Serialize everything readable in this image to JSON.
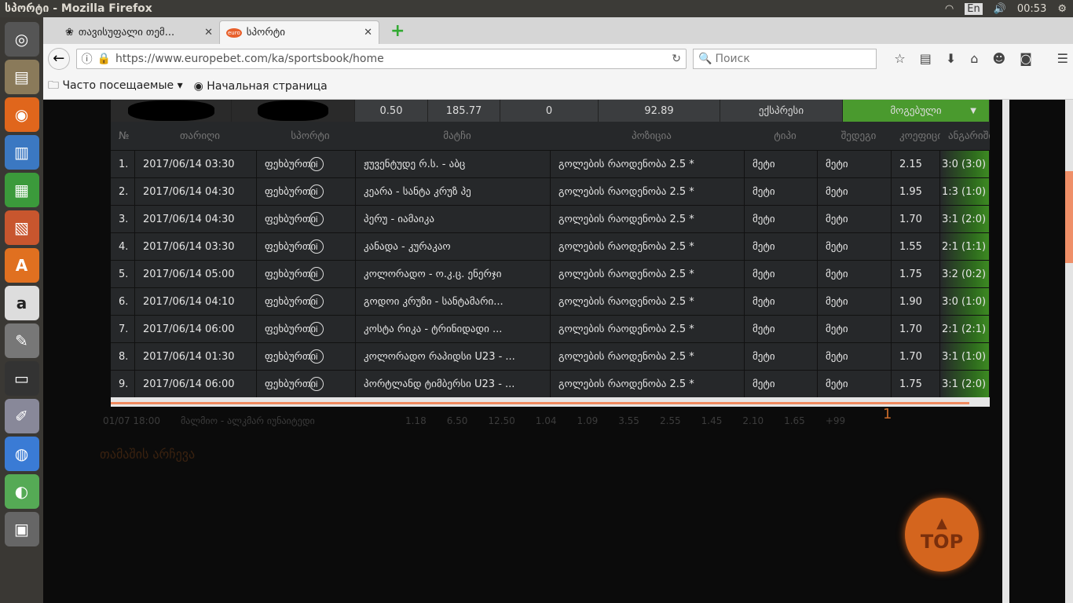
{
  "os": {
    "window_title": "სპორტი - Mozilla Firefox",
    "lang": "En",
    "time": "00:53"
  },
  "browser": {
    "tabs": [
      {
        "label": "თავისუფალი თემ..."
      },
      {
        "label": "სპორტი"
      }
    ],
    "url": "https://www.europebet.com/ka/sportsbook/home",
    "search_placeholder": "Поиск",
    "bookmarks": [
      {
        "label": "Часто посещаемые"
      },
      {
        "label": "Начальная страница"
      }
    ]
  },
  "bet_summary": {
    "stake": "0.50",
    "coef": "185.77",
    "bonus": "0",
    "win": "92.89",
    "type": "ექსპრესი",
    "status": "მოგებული"
  },
  "table": {
    "headers": [
      "№",
      "თარიღი",
      "სპორტი",
      "მატჩი",
      "პოზიცია",
      "ტიპი",
      "შედეგი",
      "კოეფიციენტი",
      "ანგარიში"
    ],
    "rows": [
      {
        "n": "1.",
        "date": "2017/06/14 03:30",
        "sport": "ფეხბურთი",
        "match": "ჟუვენტუდე რ.ს. - აბც",
        "position": "გოლების რაოდენობა 2.5 *",
        "type": "მეტი",
        "result": "მეტი",
        "coef": "2.15",
        "score": "3:0 (3:0)"
      },
      {
        "n": "2.",
        "date": "2017/06/14 04:30",
        "sport": "ფეხბურთი",
        "match": "კეარა - სანტა კრუზ პე",
        "position": "გოლების რაოდენობა 2.5 *",
        "type": "მეტი",
        "result": "მეტი",
        "coef": "1.95",
        "score": "1:3 (1:0)"
      },
      {
        "n": "3.",
        "date": "2017/06/14 04:30",
        "sport": "ფეხბურთი",
        "match": "პერუ - იამაიკა",
        "position": "გოლების რაოდენობა 2.5 *",
        "type": "მეტი",
        "result": "მეტი",
        "coef": "1.70",
        "score": "3:1 (2:0)"
      },
      {
        "n": "4.",
        "date": "2017/06/14 03:30",
        "sport": "ფეხბურთი",
        "match": "კანადა - კურაკაო",
        "position": "გოლების რაოდენობა 2.5 *",
        "type": "მეტი",
        "result": "მეტი",
        "coef": "1.55",
        "score": "2:1 (1:1)"
      },
      {
        "n": "5.",
        "date": "2017/06/14 05:00",
        "sport": "ფეხბურთი",
        "match": "კოლორადო - ო.კ.ც. ენერჯი",
        "position": "გოლების რაოდენობა 2.5 *",
        "type": "მეტი",
        "result": "მეტი",
        "coef": "1.75",
        "score": "3:2 (0:2)"
      },
      {
        "n": "6.",
        "date": "2017/06/14 04:10",
        "sport": "ფეხბურთი",
        "match": "გოდოი კრუზი - სანტამარი...",
        "position": "გოლების რაოდენობა 2.5 *",
        "type": "მეტი",
        "result": "მეტი",
        "coef": "1.90",
        "score": "3:0 (1:0)"
      },
      {
        "n": "7.",
        "date": "2017/06/14 06:00",
        "sport": "ფეხბურთი",
        "match": "კოსტა რიკა - ტრინიდადი ...",
        "position": "გოლების რაოდენობა 2.5 *",
        "type": "მეტი",
        "result": "მეტი",
        "coef": "1.70",
        "score": "2:1 (2:1)"
      },
      {
        "n": "8.",
        "date": "2017/06/14 01:30",
        "sport": "ფეხბურთი",
        "match": "კოლორადო რაპიდსი U23 - ...",
        "position": "გოლების რაოდენობა 2.5 *",
        "type": "მეტი",
        "result": "მეტი",
        "coef": "1.70",
        "score": "3:1 (1:0)"
      },
      {
        "n": "9.",
        "date": "2017/06/14 06:00",
        "sport": "ფეხბურთი",
        "match": "პორტლანდ ტიმბერსი U23 - ...",
        "position": "გოლების რაოდენობა 2.5 *",
        "type": "მეტი",
        "result": "მეტი",
        "coef": "1.75",
        "score": "3:1 (2:0)"
      }
    ]
  },
  "background": {
    "event_time": "01/07 18:00",
    "event_name": "მალმიო - ალკმარ იუნაიტედი",
    "odds": [
      "1.18",
      "6.50",
      "12.50",
      "1.04",
      "1.09",
      "3.55",
      "2.55",
      "1.45",
      "2.10",
      "1.65",
      "+99"
    ],
    "section_title": "თამაშის არჩევა",
    "pager": "1",
    "top_label": "TOP"
  },
  "colors": {
    "accent": "#ef8a60",
    "win": "#3d8a22"
  }
}
